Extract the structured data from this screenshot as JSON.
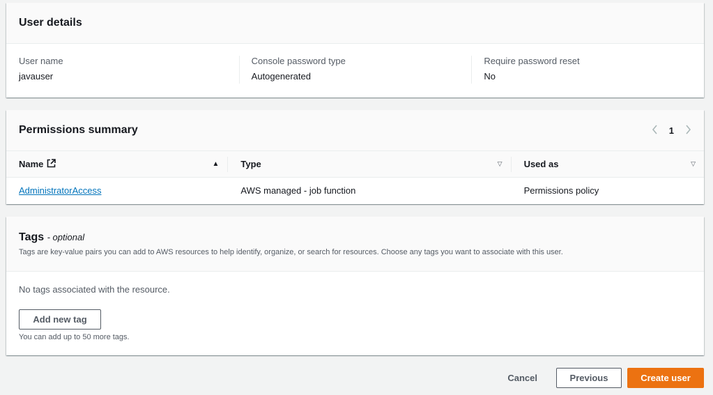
{
  "user_details": {
    "title": "User details",
    "fields": [
      {
        "label": "User name",
        "value": "javauser"
      },
      {
        "label": "Console password type",
        "value": "Autogenerated"
      },
      {
        "label": "Require password reset",
        "value": "No"
      }
    ]
  },
  "permissions": {
    "title": "Permissions summary",
    "page": "1",
    "columns": [
      "Name",
      "Type",
      "Used as"
    ],
    "rows": [
      {
        "name": "AdministratorAccess",
        "type": "AWS managed - job function",
        "used_as": "Permissions policy"
      }
    ]
  },
  "tags": {
    "title": "Tags",
    "optional": "- optional",
    "description": "Tags are key-value pairs you can add to AWS resources to help identify, organize, or search for resources. Choose any tags you want to associate with this user.",
    "empty_text": "No tags associated with the resource.",
    "add_button": "Add new tag",
    "hint": "You can add up to 50 more tags."
  },
  "actions": {
    "cancel": "Cancel",
    "previous": "Previous",
    "create": "Create user"
  },
  "colors": {
    "primary_button": "#ec7211",
    "link": "#0073bb"
  }
}
